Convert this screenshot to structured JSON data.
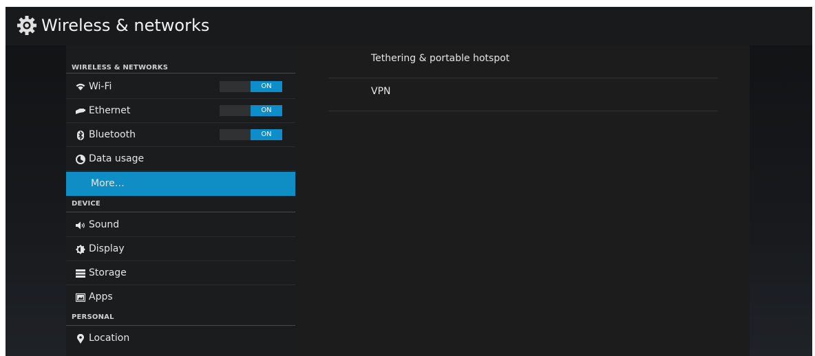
{
  "action_bar": {
    "title": "Wireless & networks",
    "icon": "gear-icon"
  },
  "sections": {
    "wireless": {
      "header": "WIRELESS & NETWORKS",
      "items": [
        {
          "label": "Wi-Fi",
          "icon": "wifi-icon",
          "toggle": "ON"
        },
        {
          "label": "Ethernet",
          "icon": "ethernet-icon",
          "toggle": "ON"
        },
        {
          "label": "Bluetooth",
          "icon": "bluetooth-icon",
          "toggle": "ON"
        },
        {
          "label": "Data usage",
          "icon": "data-usage-icon"
        },
        {
          "label": "More…",
          "selected": true
        }
      ]
    },
    "device": {
      "header": "DEVICE",
      "items": [
        {
          "label": "Sound",
          "icon": "speaker-icon"
        },
        {
          "label": "Display",
          "icon": "brightness-icon"
        },
        {
          "label": "Storage",
          "icon": "storage-icon"
        },
        {
          "label": "Apps",
          "icon": "apps-icon"
        }
      ]
    },
    "personal": {
      "header": "PERSONAL",
      "items": [
        {
          "label": "Location",
          "icon": "location-icon"
        }
      ]
    }
  },
  "detail": {
    "items": [
      {
        "label": "Tethering & portable hotspot"
      },
      {
        "label": "VPN"
      }
    ]
  },
  "colors": {
    "accent": "#0e8ec4",
    "toggle_on": "#0d8dc9"
  }
}
